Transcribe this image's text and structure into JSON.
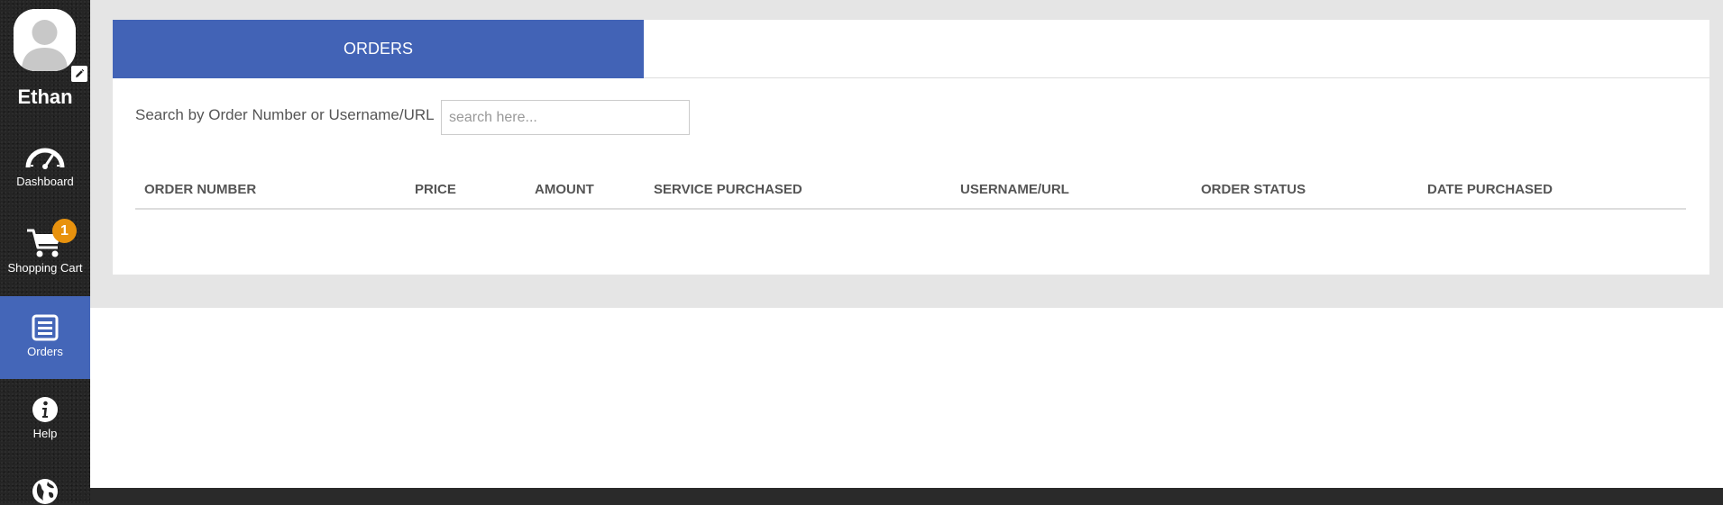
{
  "user": {
    "name": "Ethan"
  },
  "sidebar": {
    "items": [
      {
        "label": "Dashboard",
        "icon": "speedometer-icon"
      },
      {
        "label": "Shopping Cart",
        "icon": "cart-icon",
        "badge": "1"
      },
      {
        "label": "Orders",
        "icon": "list-icon",
        "active": true
      },
      {
        "label": "Help",
        "icon": "info-icon"
      },
      {
        "label": "",
        "icon": "globe-icon"
      }
    ]
  },
  "tabs": {
    "orders": "ORDERS"
  },
  "search": {
    "label": "Search by Order Number or Username/URL",
    "placeholder": "search here...",
    "value": ""
  },
  "table": {
    "columns": [
      "ORDER NUMBER",
      "PRICE",
      "AMOUNT",
      "SERVICE PURCHASED",
      "USERNAME/URL",
      "ORDER STATUS",
      "DATE PURCHASED"
    ],
    "rows": []
  },
  "colors": {
    "accent": "#4263b6",
    "sidebar_bg": "#252525",
    "badge": "#e8920e",
    "page_bg": "#e5e5e5"
  }
}
